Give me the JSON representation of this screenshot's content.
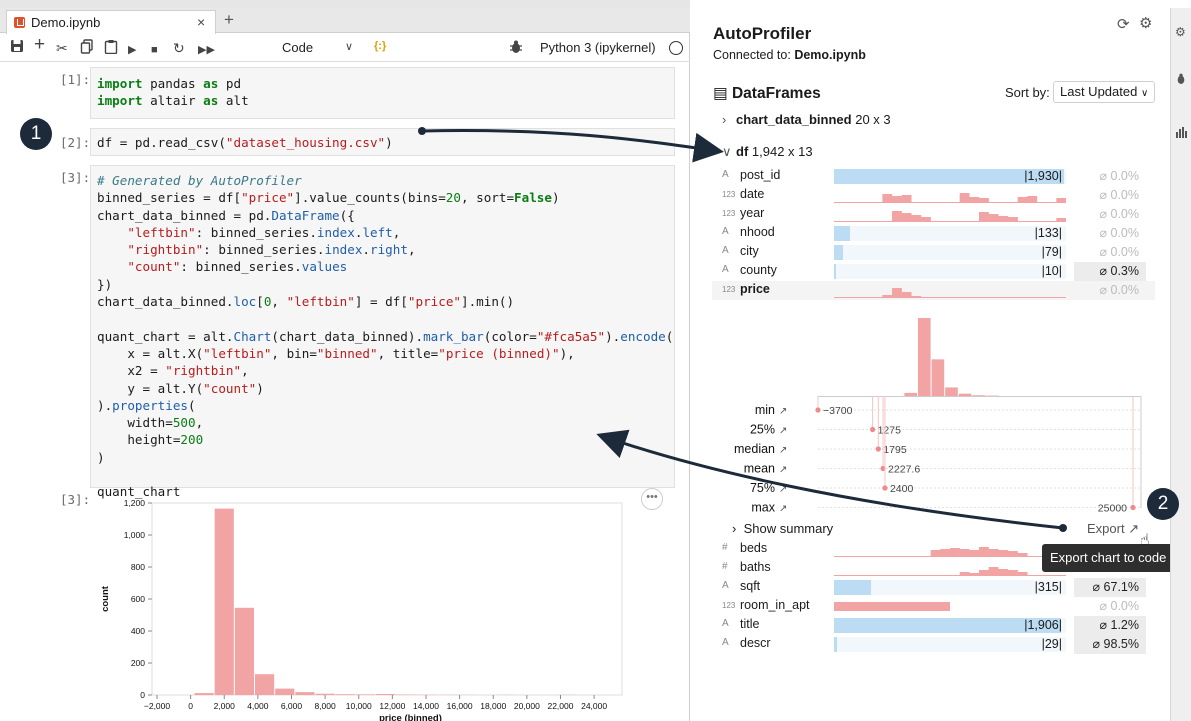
{
  "notebook": {
    "tab_title": "Demo.ipynb",
    "cell_type": "Code",
    "kernel": "Python 3 (ipykernel)",
    "variables_icon": "{:}",
    "cells": [
      {
        "prompt": "[1]:"
      },
      {
        "prompt": "[2]:"
      },
      {
        "prompt": "[3]:"
      }
    ],
    "output_prompt": "[3]:"
  },
  "badges": [
    "1",
    "2"
  ],
  "chart_data": {
    "type": "bar",
    "xlabel": "price (binned)",
    "ylabel": "count",
    "xlim": [
      -2000,
      24000
    ],
    "ylim": [
      0,
      1200
    ],
    "x_ticks": [
      "−2,000",
      "0",
      "2,000",
      "4,000",
      "6,000",
      "8,000",
      "10,000",
      "12,000",
      "14,000",
      "16,000",
      "18,000",
      "20,000",
      "22,000",
      "24,000"
    ],
    "y_ticks": [
      "0",
      "200",
      "400",
      "600",
      "800",
      "1,000",
      "1,200"
    ],
    "bins": [
      {
        "left": -3700,
        "right": 200,
        "count": 0
      },
      {
        "left": 200,
        "right": 1400,
        "count": 12
      },
      {
        "left": 1400,
        "right": 2600,
        "count": 1165
      },
      {
        "left": 2600,
        "right": 3800,
        "count": 545
      },
      {
        "left": 3800,
        "right": 5000,
        "count": 130
      },
      {
        "left": 5000,
        "right": 6200,
        "count": 40
      },
      {
        "left": 6200,
        "right": 7400,
        "count": 18
      },
      {
        "left": 7400,
        "right": 8600,
        "count": 8
      },
      {
        "left": 8600,
        "right": 9800,
        "count": 5
      },
      {
        "left": 9800,
        "right": 11000,
        "count": 4
      },
      {
        "left": 11000,
        "right": 12200,
        "count": 6
      },
      {
        "left": 12200,
        "right": 13400,
        "count": 3
      },
      {
        "left": 13400,
        "right": 14600,
        "count": 2
      },
      {
        "left": 14600,
        "right": 15800,
        "count": 1
      },
      {
        "left": 15800,
        "right": 17000,
        "count": 1
      },
      {
        "left": 17000,
        "right": 18200,
        "count": 0
      },
      {
        "left": 18200,
        "right": 19400,
        "count": 1
      },
      {
        "left": 19400,
        "right": 20600,
        "count": 0
      },
      {
        "left": 20600,
        "right": 21800,
        "count": 0
      },
      {
        "left": 21800,
        "right": 23000,
        "count": 1
      }
    ],
    "bar_color": "#f2a3a3"
  },
  "profiler": {
    "title": "AutoProfiler",
    "connected_label": "Connected to: ",
    "connected_notebook": "Demo.ipynb",
    "section_title": "DataFrames",
    "sort_label": "Sort by:",
    "sort_value": "Last Updated",
    "dataframes": [
      {
        "name": "chart_data_binned",
        "shape": "20 x 3",
        "expanded": false
      },
      {
        "name": "df",
        "shape": "1,942 x 13",
        "expanded": true
      }
    ],
    "columns_top": [
      {
        "type": "A",
        "name": "post_id",
        "viz": "unique",
        "unique": "|1,930|",
        "frac": 0.99,
        "null": "⌀ 0.0%",
        "null_hi": false
      },
      {
        "type": "123",
        "name": "date",
        "viz": "hist",
        "null": "⌀ 0.0%",
        "null_hi": false
      },
      {
        "type": "123",
        "name": "year",
        "viz": "hist",
        "null": "⌀ 0.0%",
        "null_hi": false
      },
      {
        "type": "A",
        "name": "nhood",
        "viz": "unique",
        "unique": "|133|",
        "frac": 0.07,
        "null": "⌀ 0.0%",
        "null_hi": false
      },
      {
        "type": "A",
        "name": "city",
        "viz": "unique",
        "unique": "|79|",
        "frac": 0.04,
        "null": "⌀ 0.0%",
        "null_hi": false
      },
      {
        "type": "A",
        "name": "county",
        "viz": "unique",
        "unique": "|10|",
        "frac": 0.01,
        "null": "⌀ 0.3%",
        "null_hi": true
      },
      {
        "type": "123",
        "name": "price",
        "viz": "hist",
        "null": "⌀ 0.0%",
        "null_hi": false,
        "selected": true
      }
    ],
    "stats": [
      {
        "label": "min",
        "value": "−3700"
      },
      {
        "label": "25%",
        "value": "1275"
      },
      {
        "label": "median",
        "value": "1795"
      },
      {
        "label": "mean",
        "value": "2227.6"
      },
      {
        "label": "75%",
        "value": "2400"
      },
      {
        "label": "max",
        "value": "25000"
      }
    ],
    "show_summary": "Show summary",
    "export_label": "Export",
    "export_tooltip": "Export chart to code",
    "columns_bottom": [
      {
        "type": "#",
        "name": "beds",
        "viz": "hist",
        "null": "",
        "null_hi": false
      },
      {
        "type": "#",
        "name": "baths",
        "viz": "hist",
        "null": "",
        "null_hi": false
      },
      {
        "type": "A",
        "name": "sqft",
        "viz": "unique",
        "unique": "|315|",
        "frac": 0.16,
        "null": "⌀ 67.1%",
        "null_hi": true
      },
      {
        "type": "123",
        "name": "room_in_apt",
        "viz": "redbar",
        "null": "⌀ 0.0%",
        "null_hi": false
      },
      {
        "type": "A",
        "name": "title",
        "viz": "unique",
        "unique": "|1,906|",
        "frac": 0.98,
        "null": "⌀ 1.2%",
        "null_hi": true
      },
      {
        "type": "A",
        "name": "descr",
        "viz": "unique",
        "unique": "|29|",
        "frac": 0.015,
        "null": "⌀ 98.5%",
        "null_hi": true
      }
    ]
  },
  "colors": {
    "hist": "#f2a3a3",
    "unique": "#bcdcf4",
    "badge": "#1c2a3a",
    "arrow": "#1c2a3a"
  }
}
